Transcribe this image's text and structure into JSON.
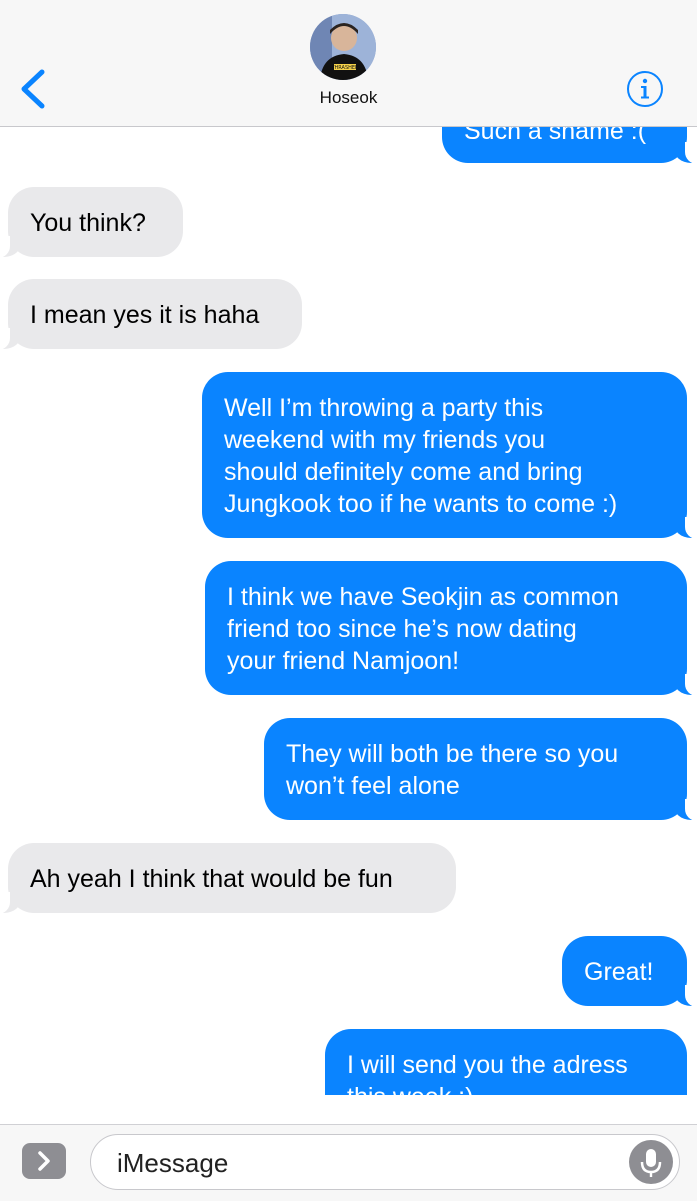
{
  "header": {
    "contact_name": "Hoseok",
    "avatar_shirt_text": "THRASHER",
    "back_icon": "chevron-left-icon",
    "info_icon": "info-circle-icon",
    "accent_color": "#0a84ff"
  },
  "messages": [
    {
      "direction": "out",
      "text": "Such a shame :("
    },
    {
      "direction": "in",
      "text": "You think?"
    },
    {
      "direction": "in",
      "text": "I mean yes it is haha"
    },
    {
      "direction": "out",
      "text": "Well I’m throwing a party this\nweekend with my friends you\nshould definitely come and bring\nJungkook too if he wants to come :)"
    },
    {
      "direction": "out",
      "text": "I think we have Seokjin as common\nfriend too since he’s now dating\nyour friend Namjoon!"
    },
    {
      "direction": "out",
      "text": "They will both be there so you\nwon’t feel alone"
    },
    {
      "direction": "in",
      "text": "Ah yeah I think that would be fun"
    },
    {
      "direction": "out",
      "text": "Great!"
    },
    {
      "direction": "out",
      "text": "I will send you the adress\nthis week :)"
    }
  ],
  "composer": {
    "placeholder": "iMessage",
    "apps_icon": "chevron-right-icon",
    "mic_icon": "microphone-icon"
  },
  "colors": {
    "outgoing_bubble": "#0a84ff",
    "incoming_bubble": "#e9e9eb"
  }
}
